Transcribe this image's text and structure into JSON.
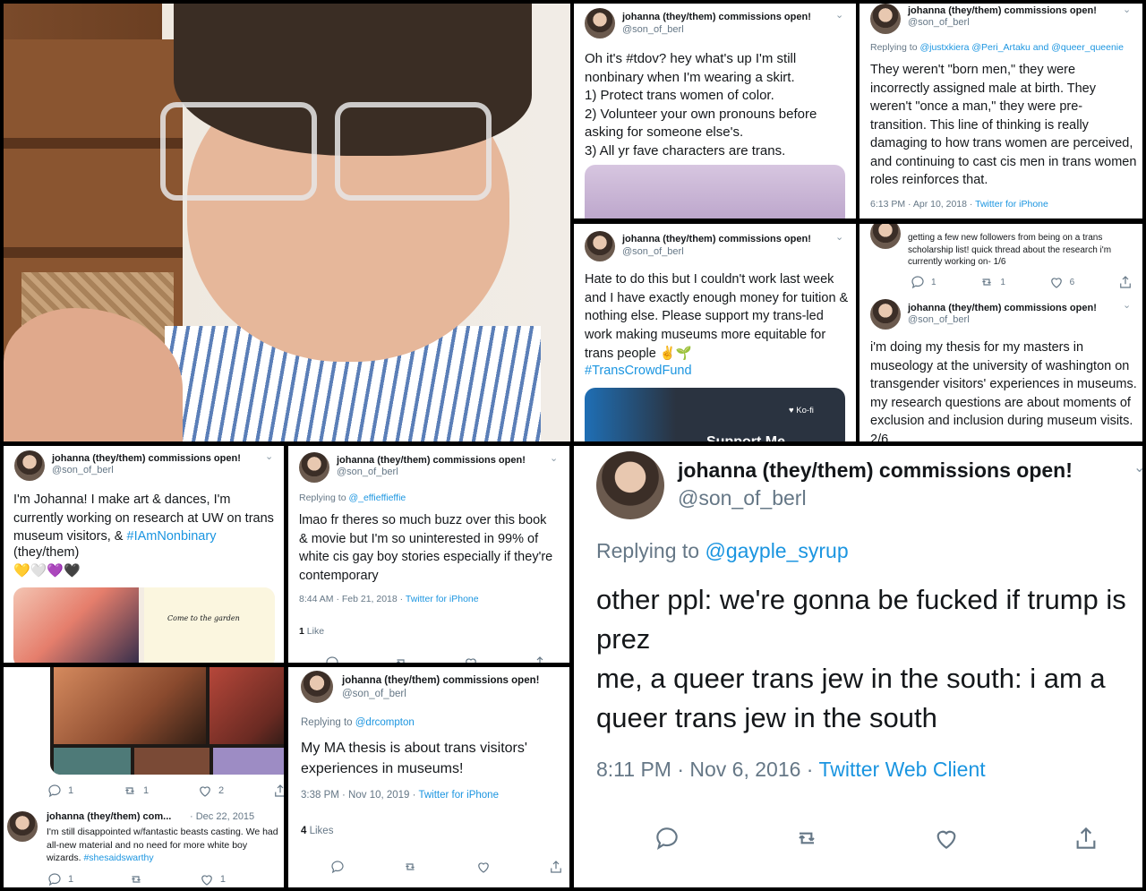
{
  "author": {
    "name": "johanna (they/them) commissions open!",
    "name_short": "johanna (they/them) com...",
    "handle": "@son_of_berl"
  },
  "tweets": {
    "t1": {
      "text": "Oh it's #tdov? hey what's up I'm still nonbinary when I'm wearing a skirt.\n1) Protect trans women of color.\n2) Volunteer your own pronouns before asking for someone else's.\n3) All yr fave characters are trans."
    },
    "t2": {
      "replying_label": "Replying to",
      "replying_to": "@justxkiera @Peri_Artaku and @queer_queenie",
      "text": "They weren't \"born men,\" they were incorrectly assigned male at birth. They weren't \"once a man,\" they were pre-transition. This line of thinking is really damaging to how trans women are perceived, and continuing to cast cis men in trans women roles reinforces that.",
      "time": "6:13 PM · Apr 10, 2018 ·",
      "client": "Twitter for iPhone"
    },
    "t3": {
      "text": "Hate to do this but I couldn't work last week and I have exactly enough money for tuition & nothing else. Please support my trans-led work making museums more equitable for trans people ✌️🌱",
      "hashtag": "#TransCrowdFund",
      "card_label": "Ko-fi",
      "card_partial": "Support Me"
    },
    "t4a": {
      "text": "getting a few new followers from being on a trans scholarship list! quick thread about the research i'm currently working on- 1/6",
      "replies": "1",
      "retweets": "1",
      "likes": "6"
    },
    "t4b": {
      "text": "i'm doing my thesis for my masters in museology at the university of washington on transgender visitors' experiences in museums. my research questions are about moments of exclusion and inclusion during museum visits. 2/6"
    },
    "t5": {
      "text": "I'm Johanna! I make art & dances, I'm currently working on research at UW on trans museum visitors, &",
      "hashtag": "#IAmNonbinary",
      "pronouns": "(they/them)",
      "hearts": "💛🤍💜🖤",
      "art_caption": "Come to the garden"
    },
    "t6": {
      "replying_label": "Replying to",
      "replying_to": "@_effieffieffie",
      "text": "lmao fr theres so much buzz over this book & movie but I'm so uninterested in 99% of white cis gay boy stories especially if they're contemporary",
      "time": "8:44 AM · Feb 21, 2018 ·",
      "client": "Twitter for iPhone",
      "likes_count": "1",
      "likes_label": "Like"
    },
    "t7": {
      "replies": "1",
      "retweets": "1",
      "likes": "2",
      "date": "Dec 22, 2015",
      "text": "I'm still disappointed w/fantastic beasts casting. We had all-new material and no need for more white boy wizards.",
      "hashtag": "#shesaidswarthy",
      "replies2": "1",
      "likes2": "1"
    },
    "t8": {
      "replying_label": "Replying to",
      "replying_to": "@drcompton",
      "text": "My MA thesis is about trans visitors' experiences in museums!",
      "time": "3:38 PM · Nov 10, 2019 ·",
      "client": "Twitter for iPhone",
      "likes_count": "4",
      "likes_label": "Likes"
    },
    "t9": {
      "replying_label": "Replying to",
      "replying_to": "@gayple_syrup",
      "text": "other ppl: we're gonna be fucked if trump is prez\nme, a queer trans jew in the south: i am a queer trans jew in the south",
      "time": "8:11 PM · Nov 6, 2016 ·",
      "client": "Twitter Web Client"
    }
  },
  "colors": {
    "link": "#1b95e0",
    "muted": "#657786",
    "background": "#000000"
  }
}
